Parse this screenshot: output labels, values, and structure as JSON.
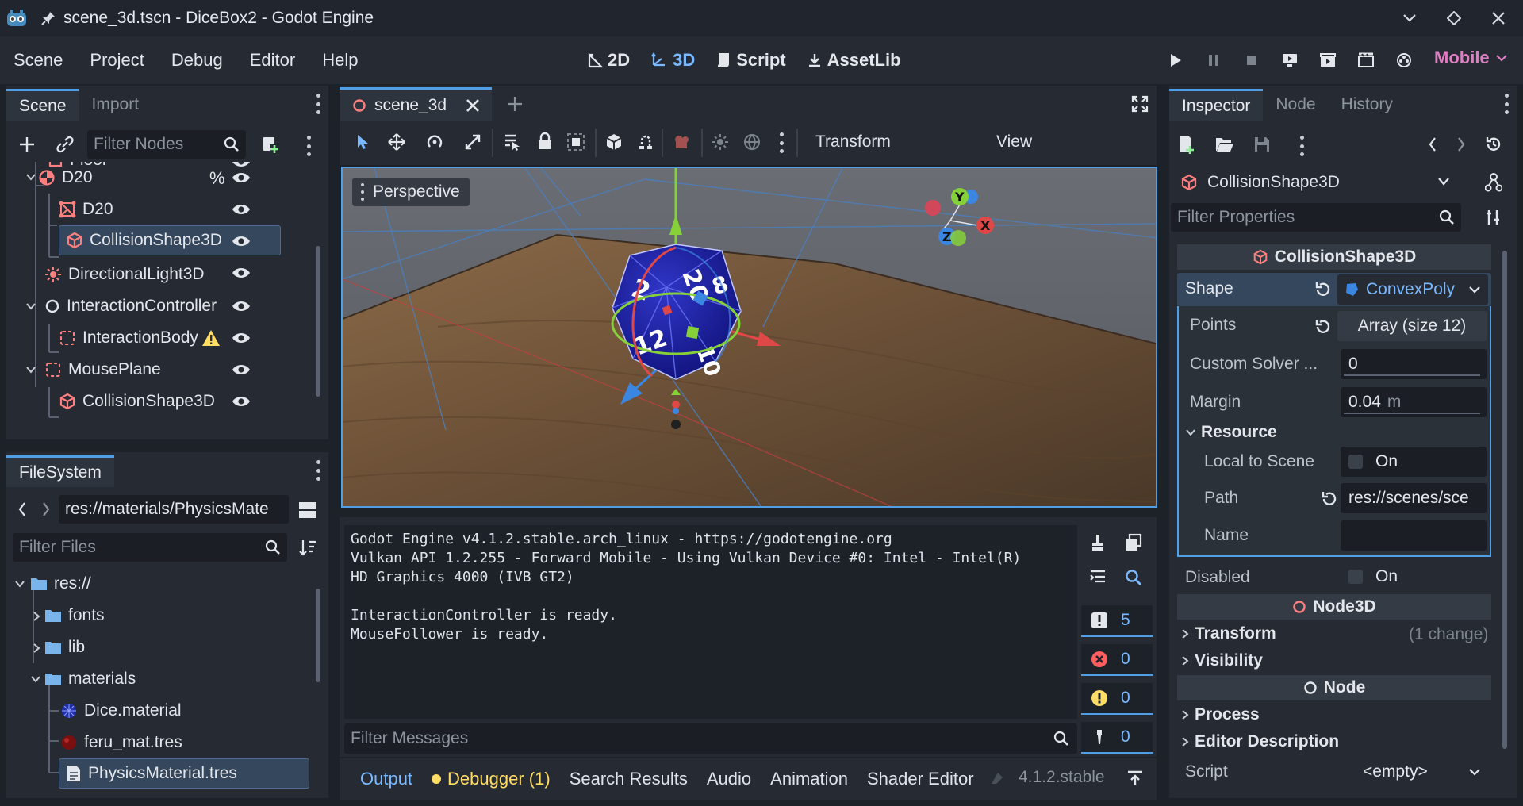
{
  "window": {
    "title": "scene_3d.tscn - DiceBox2 - Godot Engine"
  },
  "menu": [
    "Scene",
    "Project",
    "Debug",
    "Editor",
    "Help"
  ],
  "modes": [
    {
      "label": "2D",
      "icon": "2d-icon"
    },
    {
      "label": "3D",
      "icon": "3d-icon"
    },
    {
      "label": "Script",
      "icon": "script-icon"
    },
    {
      "label": "AssetLib",
      "icon": "assetlib-icon"
    }
  ],
  "renderer": "Mobile",
  "scene_dock": {
    "tabs": [
      "Scene",
      "Import"
    ],
    "filter_placeholder": "Filter Nodes",
    "nodes": [
      {
        "label": "Floor"
      },
      {
        "label": "D20",
        "badge": "%"
      },
      {
        "label": "D20"
      },
      {
        "label": "CollisionShape3D"
      },
      {
        "label": "DirectionalLight3D"
      },
      {
        "label": "InteractionController"
      },
      {
        "label": "InteractionBody"
      },
      {
        "label": "MousePlane"
      },
      {
        "label": "CollisionShape3D"
      }
    ]
  },
  "filesystem": {
    "tab": "FileSystem",
    "path": "res://materials/PhysicsMate",
    "filter_placeholder": "Filter Files",
    "items": [
      "res://",
      "fonts",
      "lib",
      "materials",
      "Dice.material",
      "feru_mat.tres",
      "PhysicsMaterial.tres"
    ]
  },
  "editor": {
    "tab": "scene_3d",
    "toolbar": {
      "transform": "Transform",
      "view": "View"
    },
    "perspective": "Perspective",
    "gizmo_axes": [
      "Y",
      "X",
      "Z"
    ],
    "dice_labels": [
      "20",
      "2",
      "8",
      "12",
      "10"
    ]
  },
  "output": {
    "lines": [
      "Godot Engine v4.1.2.stable.arch_linux - https://godotengine.org",
      "Vulkan API 1.2.255 - Forward Mobile - Using Vulkan Device #0: Intel - Intel(R)",
      "HD Graphics 4000 (IVB GT2)",
      "",
      "InteractionController is ready.",
      "MouseFollower is ready."
    ],
    "filter_placeholder": "Filter Messages",
    "counts": {
      "messages": "5",
      "errors": "0",
      "warnings": "0",
      "editor": "0"
    }
  },
  "bottom_tabs": [
    "Output",
    "Debugger (1)",
    "Search Results",
    "Audio",
    "Animation",
    "Shader Editor"
  ],
  "version": "4.1.2.stable",
  "inspector": {
    "tabs": [
      "Inspector",
      "Node",
      "History"
    ],
    "object": "CollisionShape3D",
    "filter_placeholder": "Filter Properties",
    "section_title": "CollisionShape3D",
    "shape_label": "Shape",
    "shape_value": "ConvexPoly",
    "points_label": "Points",
    "points_value": "Array (size 12)",
    "solver_label": "Custom Solver ...",
    "solver_value": "0",
    "margin_label": "Margin",
    "margin_value": "0.04",
    "margin_unit": "m",
    "resource_label": "Resource",
    "local_label": "Local to Scene",
    "on_label": "On",
    "path_label": "Path",
    "path_value": "res://scenes/sce",
    "name_label": "Name",
    "disabled_label": "Disabled",
    "node3d_title": "Node3D",
    "transform_label": "Transform",
    "transform_note": "(1 change)",
    "visibility_label": "Visibility",
    "node_title": "Node",
    "process_label": "Process",
    "editor_desc_label": "Editor Description",
    "script_label": "Script",
    "script_value": "<empty>"
  },
  "colors": {
    "accent": "#4f9ee6",
    "renderer": "#e07ec4",
    "node_icon": "#fc7f7f"
  }
}
